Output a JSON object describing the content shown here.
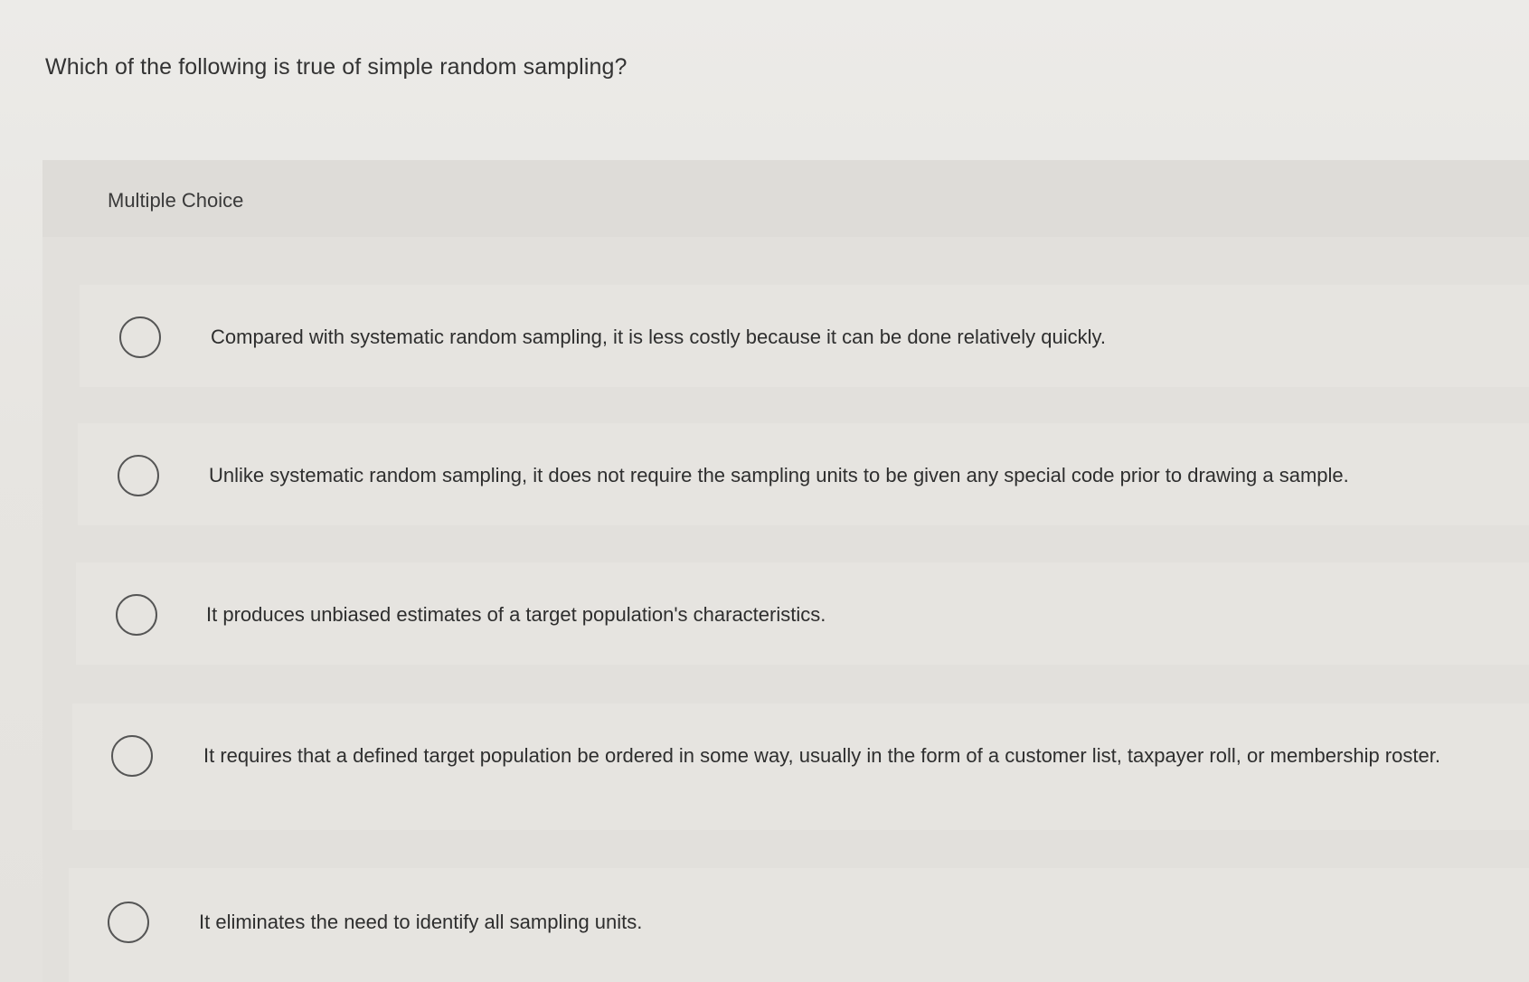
{
  "question": {
    "text": "Which of the following is true of simple random sampling?"
  },
  "multiple_choice": {
    "label": "Multiple Choice",
    "options": [
      {
        "label": "Compared with systematic random sampling, it is less costly because it can be done relatively quickly."
      },
      {
        "label": "Unlike systematic random sampling, it does not require the sampling units to be given any special code prior to drawing a sample."
      },
      {
        "label": "It produces unbiased estimates of a target population's characteristics."
      },
      {
        "label": "It requires that a defined target population be ordered in some way, usually in the form of a customer list, taxpayer roll, or membership roster."
      },
      {
        "label": "It eliminates the need to identify all sampling units."
      }
    ]
  }
}
